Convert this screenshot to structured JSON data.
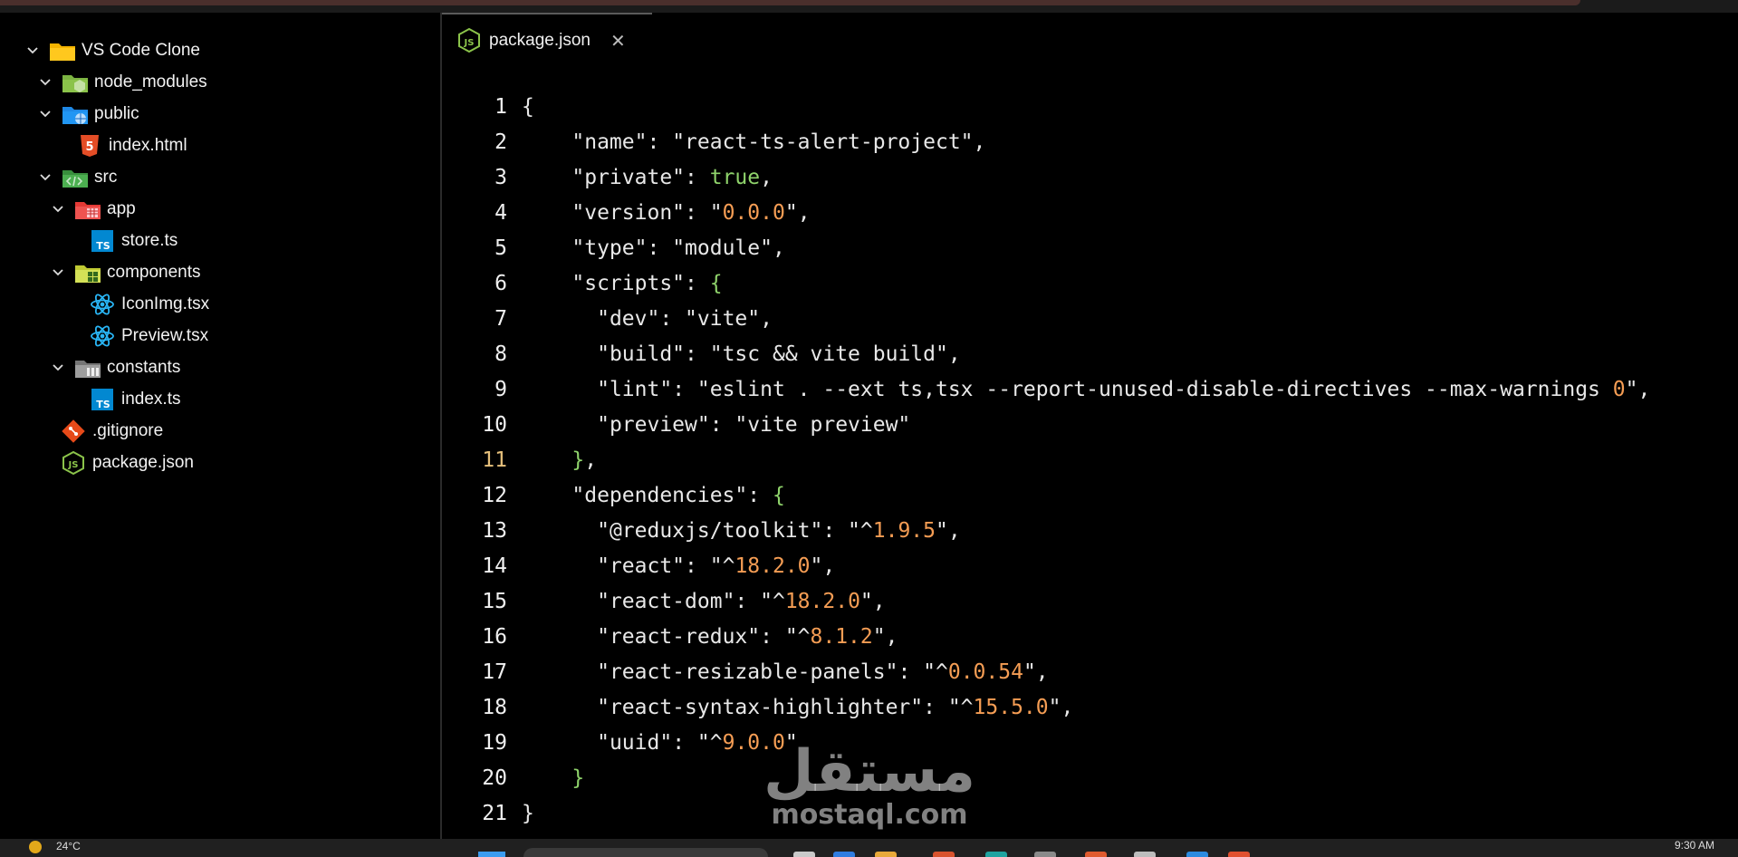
{
  "explorer": {
    "items": [
      {
        "label": "VS Code Clone",
        "icon": "folder-icon",
        "expanded": true
      },
      {
        "label": "node_modules",
        "icon": "node-folder-icon",
        "expanded": true
      },
      {
        "label": "public",
        "icon": "public-folder-icon",
        "expanded": true
      },
      {
        "label": "index.html",
        "icon": "html5-icon"
      },
      {
        "label": "src",
        "icon": "src-folder-icon",
        "expanded": true
      },
      {
        "label": "app",
        "icon": "app-folder-icon",
        "expanded": true
      },
      {
        "label": "store.ts",
        "icon": "typescript-icon"
      },
      {
        "label": "components",
        "icon": "components-folder-icon",
        "expanded": true
      },
      {
        "label": "IconImg.tsx",
        "icon": "react-icon"
      },
      {
        "label": "Preview.tsx",
        "icon": "react-icon"
      },
      {
        "label": "constants",
        "icon": "constants-folder-icon",
        "expanded": true
      },
      {
        "label": "index.ts",
        "icon": "typescript-icon"
      },
      {
        "label": ".gitignore",
        "icon": "git-icon"
      },
      {
        "label": "package.json",
        "icon": "nodejs-icon"
      }
    ]
  },
  "editor": {
    "tab": {
      "label": "package.json",
      "close": "✕",
      "icon": "nodejs-icon"
    },
    "active_line": 11,
    "lines": [
      "{",
      "    \"name\": \"react-ts-alert-project\",",
      "    \"private\": true,",
      "    \"version\": \"0.0.0\",",
      "    \"type\": \"module\",",
      "    \"scripts\": {",
      "      \"dev\": \"vite\",",
      "      \"build\": \"tsc && vite build\",",
      "      \"lint\": \"eslint . --ext ts,tsx --report-unused-disable-directives --max-warnings 0\",",
      "      \"preview\": \"vite preview\"",
      "    },",
      "    \"dependencies\": {",
      "      \"@reduxjs/toolkit\": \"^1.9.5\",",
      "      \"react\": \"^18.2.0\",",
      "      \"react-dom\": \"^18.2.0\",",
      "      \"react-redux\": \"^8.1.2\",",
      "      \"react-resizable-panels\": \"^0.0.54\",",
      "      \"react-syntax-highlighter\": \"^15.5.0\",",
      "      \"uuid\": \"^9.0.0\"",
      "    }",
      "}"
    ]
  },
  "watermark": {
    "arabic": "مستقل",
    "latin": "mostaql.com"
  },
  "taskbar": {
    "temperature": "24°C",
    "clock": "9:30 AM"
  },
  "colors": {
    "background": "#000000",
    "number": "#f59d54",
    "boolean_brace": "#8fd36b",
    "text": "#e8e8e8",
    "active_line_number": "#e6c07b"
  }
}
